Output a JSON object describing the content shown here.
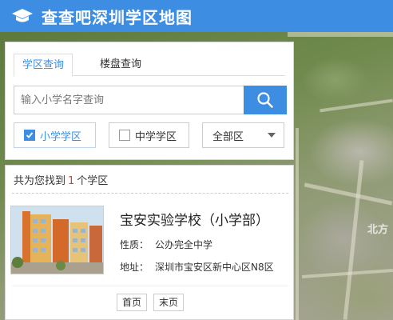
{
  "header": {
    "title": "查查吧深圳学区地图",
    "logo_icon": "graduation-cap-icon",
    "background": "#3d8ee3"
  },
  "map": {
    "district_label": "北方"
  },
  "search_panel": {
    "tabs": [
      {
        "label": "学区查询",
        "active": true
      },
      {
        "label": "楼盘查询",
        "active": false
      }
    ],
    "search_input": {
      "placeholder": "输入小学名字查询",
      "value": ""
    },
    "search_button_icon": "search-icon",
    "filters": {
      "primary": {
        "label": "小学学区",
        "checked": true
      },
      "middle": {
        "label": "中学学区",
        "checked": false
      },
      "district": {
        "label": "全部区"
      }
    }
  },
  "results": {
    "prefix": "共为您找到",
    "count": "1",
    "suffix": "个学区",
    "items": [
      {
        "name": "宝安实验学校（小学部）",
        "type_label": "性质：",
        "type_value": "公办完全中学",
        "address_label": "地址：",
        "address_value": "深圳市宝安区新中心区N8区"
      }
    ],
    "pager": {
      "first": "首页",
      "last": "末页"
    }
  },
  "accent_color": "#3d8ee3",
  "count_color": "#e23b3b"
}
